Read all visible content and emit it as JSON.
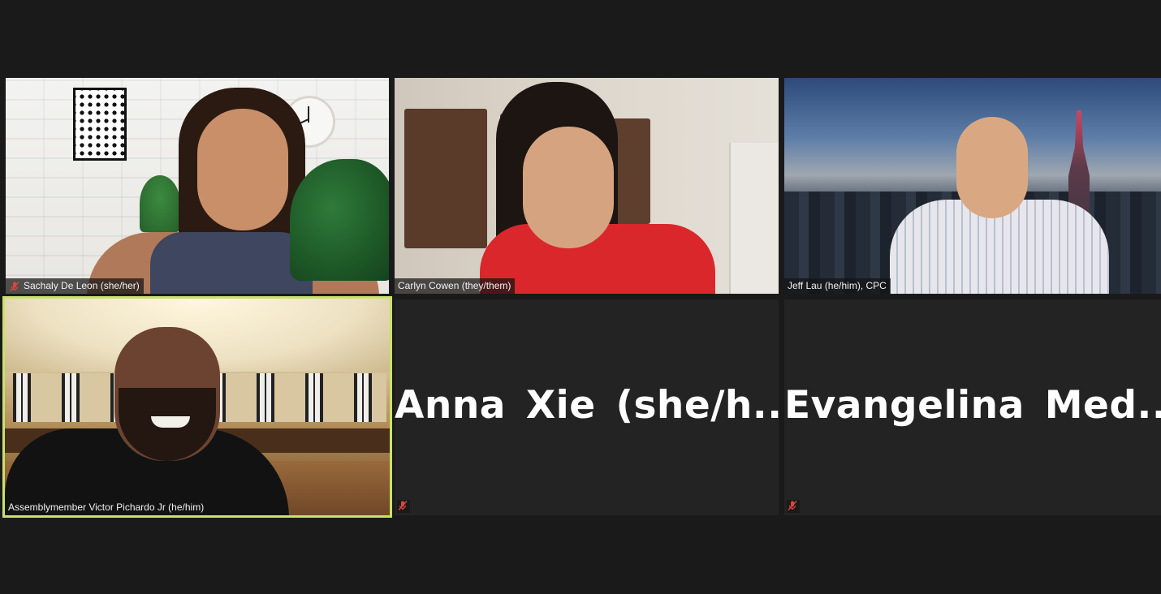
{
  "participants": [
    {
      "name": "Sachaly De Leon (she/her)",
      "muted": true,
      "video": true
    },
    {
      "name": "Carlyn Cowen (they/them)",
      "muted": false,
      "video": true
    },
    {
      "name": "Jeff Lau (he/him), CPC",
      "muted": false,
      "video": true
    },
    {
      "name": "Assemblymember Victor Pichardo Jr (he/him)",
      "muted": false,
      "video": true,
      "active_speaker": true
    },
    {
      "name": "Anna Xie (she/h...",
      "muted": true,
      "video": false
    },
    {
      "name": "Evangelina Med...",
      "muted": true,
      "video": false
    }
  ],
  "icons": {
    "mute": "mic-muted-icon"
  },
  "colors": {
    "background": "#1a1a1a",
    "tile_empty": "#232323",
    "active_border": "#c8e26a",
    "mute_red": "#e0443b"
  }
}
